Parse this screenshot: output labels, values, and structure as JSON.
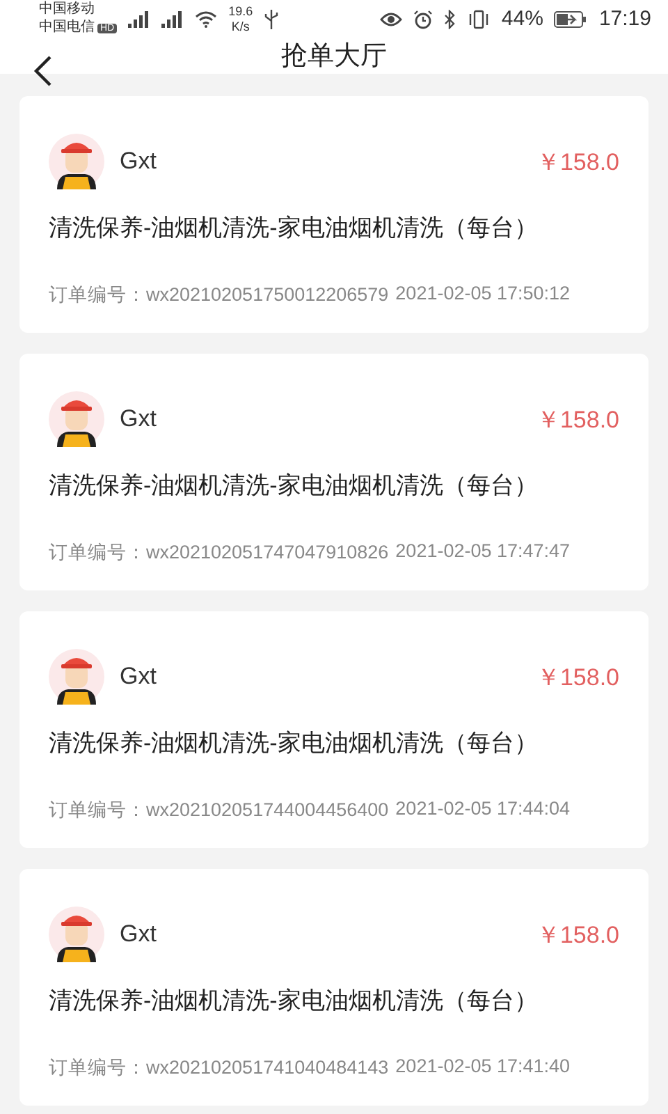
{
  "status_bar": {
    "carrier_1": "中国移动",
    "carrier_2": "中国电信",
    "hd_badge": "HD",
    "speed_value": "19.6",
    "speed_unit": "K/s",
    "battery": "44%",
    "time": "17:19"
  },
  "header": {
    "title": "抢单大厅"
  },
  "orders": [
    {
      "name": "Gxt",
      "price": "￥158.0",
      "service": "清洗保养-油烟机清洗-家电油烟机清洗（每台）",
      "order_label": "订单编号：",
      "order_no": "wx202102051750012206579",
      "time": "2021-02-05 17:50:12"
    },
    {
      "name": "Gxt",
      "price": "￥158.0",
      "service": "清洗保养-油烟机清洗-家电油烟机清洗（每台）",
      "order_label": "订单编号：",
      "order_no": "wx202102051747047910826",
      "time": "2021-02-05 17:47:47"
    },
    {
      "name": "Gxt",
      "price": "￥158.0",
      "service": "清洗保养-油烟机清洗-家电油烟机清洗（每台）",
      "order_label": "订单编号：",
      "order_no": "wx202102051744004456400",
      "time": "2021-02-05 17:44:04"
    },
    {
      "name": "Gxt",
      "price": "￥158.0",
      "service": "清洗保养-油烟机清洗-家电油烟机清洗（每台）",
      "order_label": "订单编号：",
      "order_no": "wx202102051741040484143",
      "time": "2021-02-05 17:41:40"
    }
  ]
}
